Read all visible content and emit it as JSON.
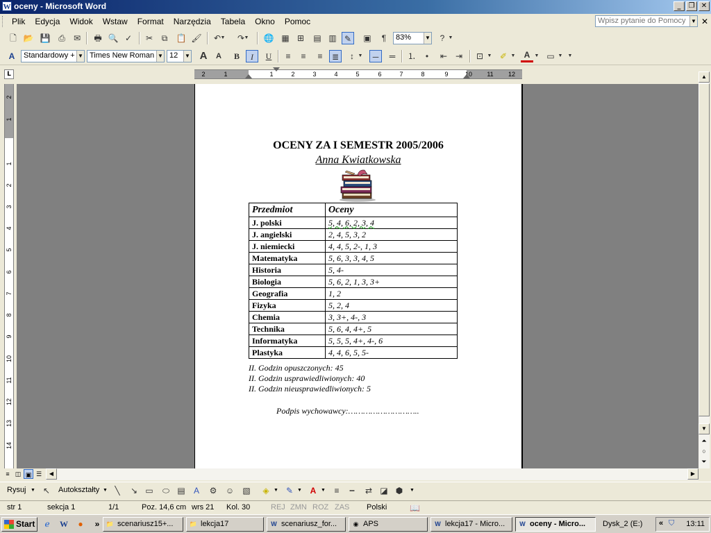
{
  "window": {
    "title": "oceny - Microsoft Word",
    "app_icon": "W"
  },
  "menu": [
    "Plik",
    "Edycja",
    "Widok",
    "Wstaw",
    "Format",
    "Narzędzia",
    "Tabela",
    "Okno",
    "Pomoc"
  ],
  "help_placeholder": "Wpisz pytanie do Pomocy",
  "toolbar": {
    "zoom": "83%",
    "style": "Standardowy +",
    "font": "Times New Roman",
    "size": "12"
  },
  "ruler": {
    "h_labels": [
      "2",
      "1",
      "1",
      "2",
      "3",
      "4",
      "5",
      "6",
      "7",
      "8",
      "9",
      "10",
      "11",
      "12"
    ],
    "v_labels": [
      "2",
      "1",
      "1",
      "2",
      "3",
      "4",
      "5",
      "6",
      "7",
      "8",
      "9",
      "10",
      "11",
      "12",
      "13",
      "14"
    ],
    "tab_selector": "L"
  },
  "document": {
    "title": "OCENY ZA I SEMESTR 2005/2006",
    "name": "Anna Kwiatkowska",
    "table": {
      "headers": [
        "Przedmiot",
        "Oceny"
      ],
      "rows": [
        [
          "J. polski",
          "5, 4, 6, 2, 3, 4"
        ],
        [
          "J. angielski",
          "2, 4, 5, 3, 2"
        ],
        [
          "J. niemiecki",
          "4, 4, 5, 2-, 1, 3"
        ],
        [
          "Matematyka",
          "5, 6, 3, 3, 4, 5"
        ],
        [
          "Historia",
          "5, 4-"
        ],
        [
          "Biologia",
          "5, 6, 2, 1, 3, 3+"
        ],
        [
          "Geografia",
          "1, 2"
        ],
        [
          "Fizyka",
          "5, 2, 4"
        ],
        [
          "Chemia",
          "3, 3+, 4-, 3"
        ],
        [
          "Technika",
          "5, 6, 4, 4+, 5"
        ],
        [
          "Informatyka",
          "5, 5, 5, 4+, 4-, 6"
        ],
        [
          "Plastyka",
          "4, 4, 6, 5, 5-"
        ]
      ]
    },
    "notes": [
      "II. Godzin opuszczonych: 45",
      "II. Godzin usprawiedliwionych: 40",
      "II. Godzin nieusprawiedliwionych: 5"
    ],
    "signature": "Podpis wychowawcy:……………………….."
  },
  "drawbar": {
    "draw": "Rysuj",
    "autoshapes": "Autokształty"
  },
  "status": {
    "page": "str  1",
    "section": "sekcja  1",
    "pages": "1/1",
    "position": "Poz. 14,6 cm",
    "line": "wrs  21",
    "column": "Kol.  30",
    "rej": "REJ",
    "zmn": "ZMN",
    "roz": "ROZ",
    "zas": "ZAS",
    "language": "Polski"
  },
  "taskbar": {
    "start": "Start",
    "tasks": [
      "scenariusz15+...",
      "lekcja17",
      "scenariusz_for...",
      "APS",
      "lekcja17 - Micro...",
      "oceny - Micro..."
    ],
    "drive": "Dysk_2 (E:)",
    "clock": "13:11"
  }
}
